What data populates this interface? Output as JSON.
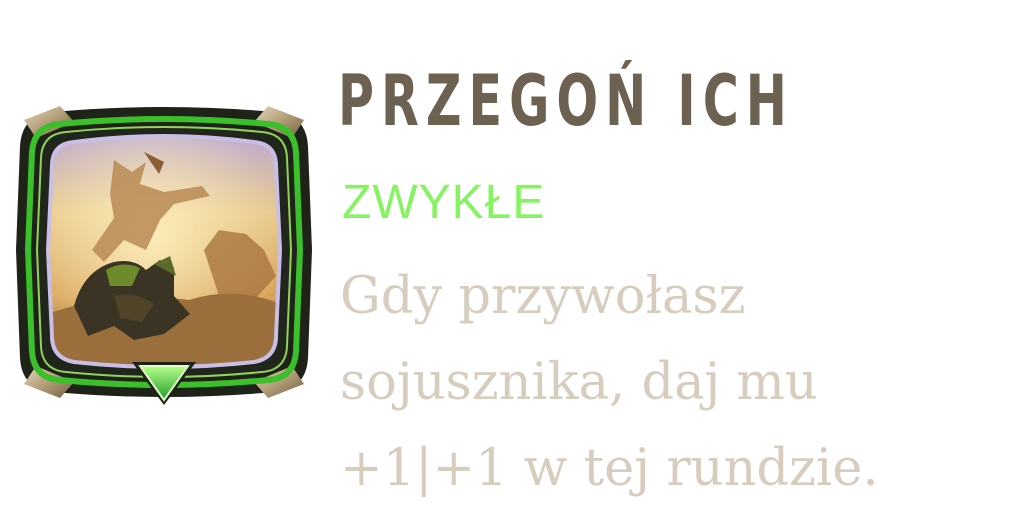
{
  "ability": {
    "title": "PRZEGOŃ ICH",
    "rarity": "ZWYKŁE",
    "description_lines": [
      "Gdy przywołasz",
      "sojusznika, daj mu",
      "+1|+1 w tej rundzie."
    ]
  },
  "icon": {
    "name": "augment-art-icon",
    "badge": "rarity-triangle-icon"
  },
  "colors": {
    "title": "#6d6152",
    "rarity": "#86f361",
    "description": "#d7cdbf",
    "frame_green": "#3bbf2a",
    "frame_dark": "#1e2219"
  }
}
